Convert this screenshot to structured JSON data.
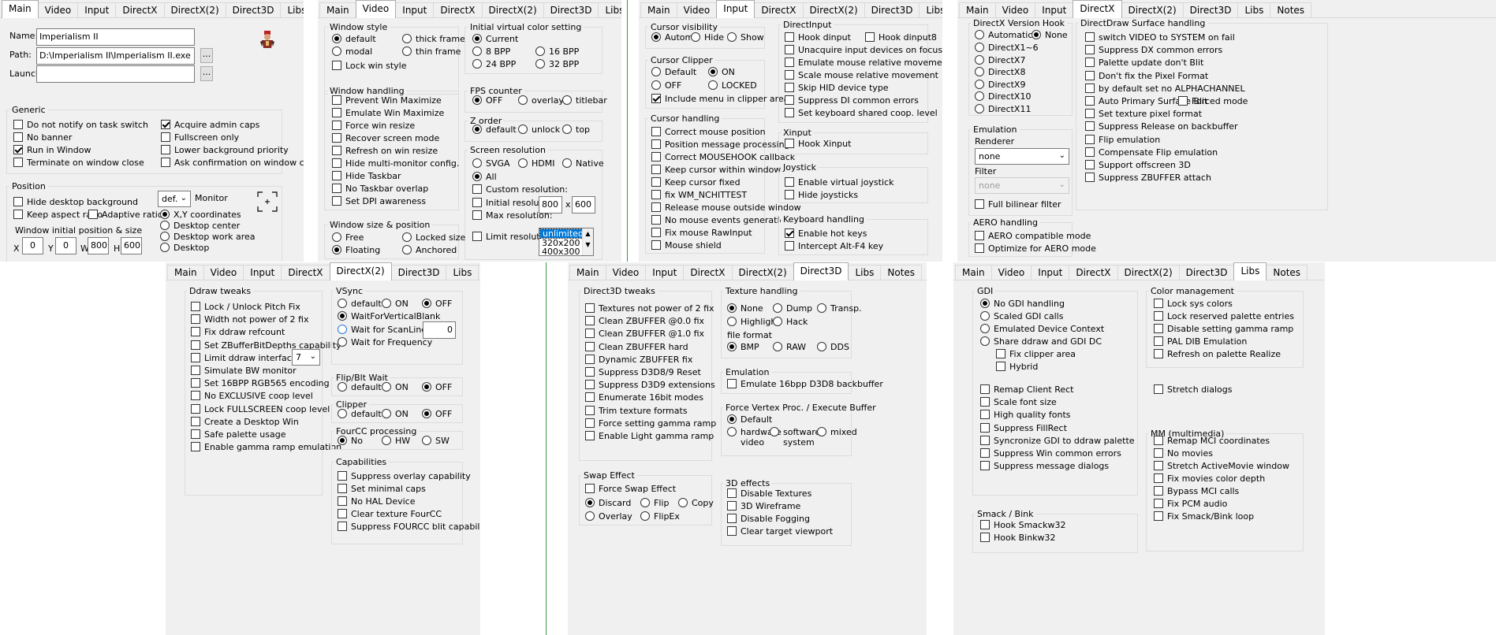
{
  "tabs": [
    "Main",
    "Video",
    "Input",
    "DirectX",
    "DirectX(2)",
    "Direct3D",
    "Libs",
    "Notes"
  ],
  "main": {
    "name_label": "Name:",
    "name_value": "Imperialism II",
    "path_label": "Path:",
    "path_value": "D:\\Imperialism II\\Imperialism II.exe",
    "launch_label": "Launch:",
    "launch_value": "",
    "browse": "...",
    "generic_title": "Generic",
    "generic_items": [
      {
        "label": "Do not notify on task switch",
        "checked": false
      },
      {
        "label": "No banner",
        "checked": false
      },
      {
        "label": "Run in Window",
        "checked": true
      },
      {
        "label": "Terminate on window close",
        "checked": false
      },
      {
        "label": "Acquire admin caps",
        "checked": true
      },
      {
        "label": "Fullscreen only",
        "checked": false
      },
      {
        "label": "Lower background priority",
        "checked": false
      },
      {
        "label": "Ask confirmation on window close",
        "checked": false
      }
    ],
    "position_title": "Position",
    "hide_desktop_bg": "Hide desktop background",
    "keep_aspect": "Keep aspect ratio",
    "adaptive_ratio": "Adaptive ratio",
    "monitor_value": "def.",
    "monitor_label": "Monitor",
    "pos_modes": [
      {
        "label": "X,Y coordinates",
        "checked": true
      },
      {
        "label": "Desktop center",
        "checked": false
      },
      {
        "label": "Desktop work area",
        "checked": false
      },
      {
        "label": "Desktop",
        "checked": false
      }
    ],
    "initpos_label": "Window initial position & size",
    "x_label": "X",
    "x": "0",
    "y_label": "Y",
    "y": "0",
    "w_label": "W",
    "w": "800",
    "h_label": "H",
    "h": "600"
  },
  "video": {
    "window_style_title": "Window style",
    "style_default": "default",
    "style_thick": "thick frame",
    "style_modal": "modal",
    "style_thin": "thin frame",
    "lock_win_style": "Lock win style",
    "ivc_title": "Initial virtual color setting",
    "ivc_current": "Current",
    "ivc_8": "8 BPP",
    "ivc_16": "16 BPP",
    "ivc_24": "24 BPP",
    "ivc_32": "32 BPP",
    "handling_title": "Window handling",
    "handling_items": [
      "Prevent Win Maximize",
      "Emulate Win Maximize",
      "Force win resize",
      "Recover screen mode",
      "Refresh on win resize",
      "Hide multi-monitor config.",
      "Hide Taskbar",
      "No Taskbar overlap",
      "Set DPI awareness"
    ],
    "fps_title": "FPS counter",
    "fps_off": "OFF",
    "fps_overlay": "overlay",
    "fps_titlebar": "titlebar",
    "z_title": "Z order",
    "z_default": "default",
    "z_unlock": "unlock",
    "z_top": "top",
    "res_title": "Screen resolution",
    "res_svga": "SVGA",
    "res_hdmi": "HDMI",
    "res_native": "Native",
    "res_all": "All",
    "custom_res": "Custom resolution:",
    "initial_res": "Initial resolution:",
    "init_w": "800",
    "x_sep": "x",
    "init_h": "600",
    "max_res": "Max resolution:",
    "limit_res": "Limit  resolution:",
    "limit_options": [
      "unlimited",
      "320x200",
      "400x300"
    ],
    "size_title": "Window size & position",
    "size_free": "Free",
    "size_locked": "Locked size",
    "size_floating": "Floating",
    "size_anchored": "Anchored"
  },
  "input": {
    "vis_title": "Cursor visibility",
    "vis_auto": "Autom.",
    "vis_hide": "Hide",
    "vis_show": "Show",
    "clip_title": "Cursor Clipper",
    "clip_default": "Default",
    "clip_on": "ON",
    "clip_off": "OFF",
    "clip_locked": "LOCKED",
    "clip_menu": "Include menu in clipper area",
    "handling_title": "Cursor handling",
    "handling_items": [
      "Correct mouse position",
      "Position message processing",
      "Correct MOUSEHOOK callback",
      "Keep cursor within window",
      "Keep cursor fixed",
      "fix WM_NCHITTEST",
      "Release mouse outside window",
      "No mouse events generation",
      "Fix mouse RawInput",
      "Mouse shield"
    ],
    "di_title": "DirectInput",
    "di_hook": "Hook dinput",
    "di_hook8": "Hook dinput8",
    "di_items": [
      "Unacquire input devices on focus lost",
      "Emulate mouse relative movement",
      "Scale mouse relative movement",
      "Skip HID device type",
      "Suppress DI common errors",
      "Set keyboard shared coop. level"
    ],
    "xi_title": "Xinput",
    "xi_hook": "Hook Xinput",
    "joy_title": "Joystick",
    "joy_enable": "Enable virtual joystick",
    "joy_hide": "Hide joysticks",
    "kb_title": "Keyboard handling",
    "kb_hot": "Enable hot keys",
    "kb_alt": "Intercept Alt-F4 key"
  },
  "directx": {
    "hook_title": "DirectX Version Hook",
    "hook_auto": "Automatic",
    "hook_none": "None",
    "hook_versions": [
      "DirectX1~6",
      "DirectX7",
      "DirectX8",
      "DirectX9",
      "DirectX10",
      "DirectX11"
    ],
    "emu_title": "Emulation",
    "renderer_label": "Renderer",
    "renderer_value": "none",
    "filter_label": "Filter",
    "filter_value": "none",
    "bilinear": "Full bilinear filter",
    "aero_title": "AERO handling",
    "aero_compat": "AERO compatible mode",
    "aero_opt": "Optimize for AERO mode",
    "dd_title": "DirectDraw Surface handling",
    "dd_items": [
      "switch VIDEO to SYSTEM on fail",
      "Suppress DX common errors",
      "Palette update don't Blit",
      "Don't fix the Pixel Format",
      "by default set no ALPHACHANNEL",
      "Auto Primary Surface Blit",
      "Set texture pixel format",
      "Suppress Release on backbuffer",
      "Flip emulation",
      "Compensate Flip emulation",
      "Support offscreen 3D",
      "Suppress ZBUFFER attach"
    ],
    "forced_mode": "Forced mode"
  },
  "directx2": {
    "tweaks_title": "Ddraw tweaks",
    "tweaks": [
      "Lock / Unlock Pitch Fix",
      "Width not power of 2 fix",
      "Fix ddraw refcount",
      "Set ZBufferBitDepths capability",
      "Limit ddraw interface",
      "Simulate BW monitor",
      "Set 16BPP RGB565 encoding",
      "No EXCLUSIVE coop level",
      "Lock FULLSCREEN coop level",
      "Create a Desktop Win",
      "Safe palette usage",
      "Enable gamma ramp emulation"
    ],
    "limit_value": "7",
    "vsync_title": "VSync",
    "vs_default": "default",
    "vs_on": "ON",
    "vs_off": "OFF",
    "vs_wfvb": "WaitForVerticalBlank",
    "vs_scan": "Wait for ScanLine ---->",
    "vs_scan_val": "0",
    "vs_freq": "Wait for Frequency",
    "flip_title": "Flip/Blt Wait",
    "flip_default": "default",
    "flip_on": "ON",
    "flip_off": "OFF",
    "clip_title": "Clipper",
    "clip_default": "default",
    "clip_on": "ON",
    "clip_off": "OFF",
    "fourcc_title": "FourCC processing",
    "fc_no": "No",
    "fc_hw": "HW",
    "fc_sw": "SW",
    "caps_title": "Capabilities",
    "caps": [
      "Suppress overlay capability",
      "Set minimal caps",
      "No HAL Device",
      "Clear texture FourCC",
      "Suppress FOURCC blit capability"
    ]
  },
  "direct3d": {
    "tweaks_title": "Direct3D tweaks",
    "tweaks": [
      "Textures not power of 2 fix",
      "Clean ZBUFFER @0.0 fix",
      "Clean ZBUFFER @1.0 fix",
      "Clean ZBUFFER hard",
      "Dynamic ZBUFFER fix",
      "Suppress D3D8/9 Reset",
      "Suppress D3D9 extensions",
      "Enumerate 16bit modes",
      "Trim texture formats",
      "Force setting gamma ramp",
      "Enable Light gamma ramp"
    ],
    "tex_title": "Texture handling",
    "tex_none": "None",
    "tex_dump": "Dump",
    "tex_transp": "Transp.",
    "tex_highlight": "Highlight",
    "tex_hack": "Hack",
    "ff_label": "file format",
    "ff_bmp": "BMP",
    "ff_raw": "RAW",
    "ff_dds": "DDS",
    "emu_title": "Emulation",
    "emu_16": "Emulate 16bpp D3D8 backbuffer",
    "fvp_title": "Force Vertex Proc. / Execute Buffer",
    "fvp_default": "Default",
    "fvp_hw": "hardware",
    "fvp_hw2": "video",
    "fvp_sw": "software",
    "fvp_sw2": "system",
    "fvp_mixed": "mixed",
    "e3d_title": "3D effects",
    "e3d": [
      "Disable Textures",
      "3D Wireframe",
      "Disable Fogging",
      "Clear target viewport"
    ],
    "swap_title": "Swap Effect",
    "swap_force": "Force Swap Effect",
    "swap_discard": "Discard",
    "swap_flip": "Flip",
    "swap_copy": "Copy",
    "swap_overlay": "Overlay",
    "swap_flipex": "FlipEx"
  },
  "libs": {
    "gdi_title": "GDI",
    "gdi_modes": [
      {
        "label": "No GDI handling",
        "checked": true
      },
      {
        "label": "Scaled GDI calls",
        "checked": false
      },
      {
        "label": "Emulated Device Context",
        "checked": false
      },
      {
        "label": "Share ddraw and GDI DC",
        "checked": false
      }
    ],
    "gdi_fix": "Fix clipper area",
    "gdi_hybrid": "Hybrid",
    "gdi_items": [
      "Remap Client Rect",
      "Scale font size",
      "High quality fonts",
      "Suppress FillRect",
      "Syncronize GDI to ddraw palette",
      "Suppress Win common errors",
      "Suppress message dialogs"
    ],
    "color_title": "Color management",
    "color_items": [
      "Lock sys colors",
      "Lock reserved palette entries",
      "Disable setting gamma ramp",
      "PAL DIB Emulation",
      "Refresh on palette Realize"
    ],
    "stretch": "Stretch dialogs",
    "mm_title": "MM (multimedia)",
    "mm_items": [
      "Remap MCI coordinates",
      "No movies",
      "Stretch ActiveMovie window",
      "Fix movies color depth",
      "Bypass MCI calls",
      "Fix PCM audio",
      "Fix Smack/Bink loop"
    ],
    "smack_title": "Smack / Bink",
    "smack_items": [
      "Hook Smackw32",
      "Hook Binkw32"
    ]
  }
}
